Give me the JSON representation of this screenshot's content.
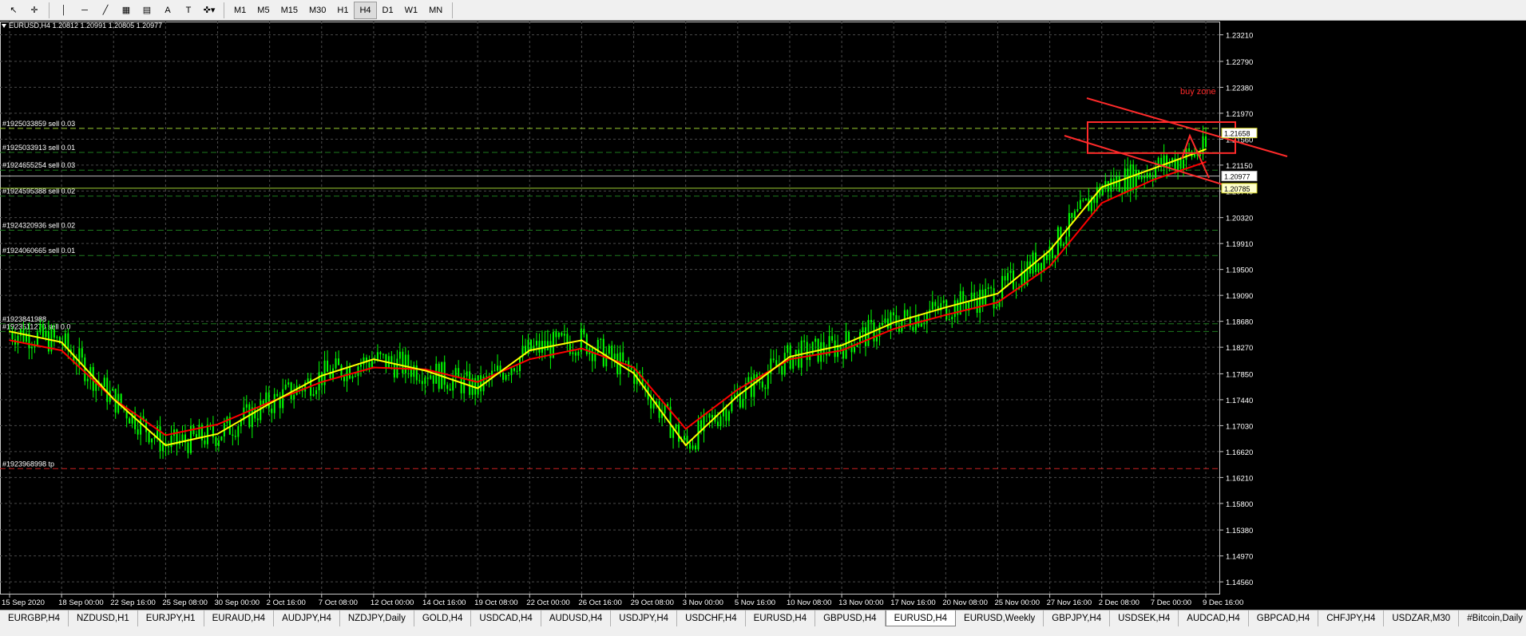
{
  "toolbar": {
    "tools": [
      {
        "name": "cursor-icon",
        "glyph": "↖"
      },
      {
        "name": "crosshair-icon",
        "glyph": "✛"
      },
      {
        "name": "vertical-line-icon",
        "glyph": "│"
      },
      {
        "name": "horizontal-line-icon",
        "glyph": "─"
      },
      {
        "name": "trendline-icon",
        "glyph": "╱"
      },
      {
        "name": "fibonacci-icon",
        "glyph": "▦"
      },
      {
        "name": "fibonacci-fan-icon",
        "glyph": "▤"
      },
      {
        "name": "text-icon",
        "glyph": "A"
      },
      {
        "name": "text-label-icon",
        "glyph": "T"
      },
      {
        "name": "shapes-dropdown-icon",
        "glyph": "✜▾"
      }
    ],
    "timeframes": [
      "M1",
      "M5",
      "M15",
      "M30",
      "H1",
      "H4",
      "D1",
      "W1",
      "MN"
    ],
    "active_timeframe": "H4"
  },
  "chart": {
    "info_label": "EURUSD,H4  1.20812 1.20991 1.20805 1.20977",
    "buy_zone_label": "buy zone",
    "price_labels": [
      "1.23210",
      "1.22790",
      "1.22380",
      "1.21970",
      "1.21560",
      "1.21150",
      "1.20740",
      "1.20320",
      "1.19910",
      "1.19500",
      "1.19090",
      "1.18680",
      "1.18270",
      "1.17850",
      "1.17440",
      "1.17030",
      "1.16620",
      "1.16210",
      "1.15800",
      "1.15380",
      "1.14970",
      "1.14560"
    ],
    "highlighted_prices": [
      {
        "text": "1.21658",
        "bg": "#ffffff",
        "fg": "#000000",
        "border": "#d0d020"
      },
      {
        "text": "1.20977",
        "bg": "#ffffff",
        "fg": "#000000",
        "border": "#c0c0c0"
      },
      {
        "text": "1.20785",
        "bg": "#ffffcc",
        "fg": "#000000",
        "border": "#d0d020"
      }
    ],
    "orders": [
      "#1925033859 sell 0.03",
      "#1925033913 sell 0.01",
      "#1924655254 sell 0.03",
      "#1924595388 sell 0.02",
      "#1924320936 sell 0.02",
      "#1924060665 sell 0.01",
      "#1923841988",
      "#1923511270 sell 0.0",
      "#1923968998 tp"
    ],
    "time_labels": [
      "15 Sep 2020",
      "18 Sep 00:00",
      "22 Sep 16:00",
      "25 Sep 08:00",
      "30 Sep 00:00",
      "2 Oct 16:00",
      "7 Oct 08:00",
      "12 Oct 00:00",
      "14 Oct 16:00",
      "19 Oct 08:00",
      "22 Oct 00:00",
      "26 Oct 16:00",
      "29 Oct 08:00",
      "3 Nov 00:00",
      "5 Nov 16:00",
      "10 Nov 08:00",
      "13 Nov 00:00",
      "17 Nov 16:00",
      "20 Nov 08:00",
      "25 Nov 00:00",
      "27 Nov 16:00",
      "2 Dec 08:00",
      "7 Dec 00:00",
      "9 Dec 16:00"
    ],
    "colors": {
      "candles": "#00ff00",
      "ma_fast": "#ffff00",
      "ma_slow": "#ff0000",
      "grid": "#4a4a4a",
      "annotation": "#ff2a2a"
    }
  },
  "chart_data": {
    "type": "line",
    "title": "EURUSD,H4",
    "xlabel": "",
    "ylabel": "",
    "ylim": [
      1.1436,
      1.2342
    ],
    "x": [
      "15 Sep 2020",
      "18 Sep 00:00",
      "22 Sep 16:00",
      "25 Sep 08:00",
      "30 Sep 00:00",
      "2 Oct 16:00",
      "7 Oct 08:00",
      "12 Oct 00:00",
      "14 Oct 16:00",
      "19 Oct 08:00",
      "22 Oct 00:00",
      "26 Oct 16:00",
      "29 Oct 08:00",
      "3 Nov 00:00",
      "5 Nov 16:00",
      "10 Nov 08:00",
      "13 Nov 00:00",
      "17 Nov 16:00",
      "20 Nov 08:00",
      "25 Nov 00:00",
      "27 Nov 16:00",
      "2 Dec 08:00",
      "7 Dec 00:00",
      "9 Dec 16:00"
    ],
    "series": [
      {
        "values": [
          1.1852,
          1.1835,
          1.1745,
          1.1672,
          1.169,
          1.1738,
          1.1782,
          1.1808,
          1.179,
          1.1762,
          1.1822,
          1.1838,
          1.1786,
          1.1672,
          1.175,
          1.1812,
          1.183,
          1.1866,
          1.189,
          1.1912,
          1.198,
          1.208,
          1.211,
          1.214
        ]
      },
      {
        "values": [
          1.1838,
          1.1822,
          1.1745,
          1.1688,
          1.1705,
          1.174,
          1.1772,
          1.1795,
          1.1792,
          1.1772,
          1.1808,
          1.1825,
          1.1795,
          1.1698,
          1.176,
          1.1808,
          1.1822,
          1.1856,
          1.1878,
          1.1898,
          1.1955,
          1.2055,
          1.2092,
          1.212
        ]
      }
    ],
    "grid": true,
    "legend": "none"
  }
}
